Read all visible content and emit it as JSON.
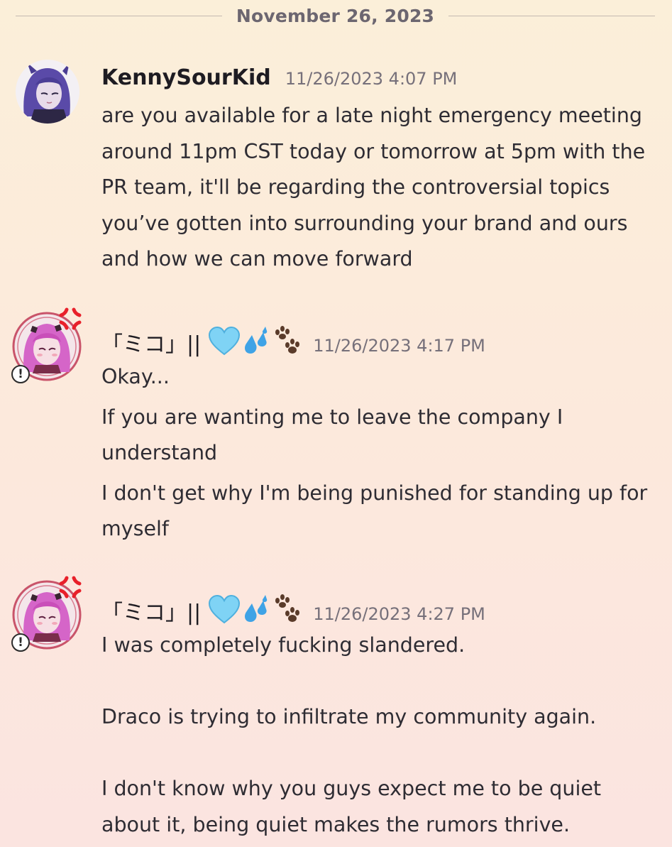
{
  "date_divider": "November 26, 2023",
  "messages": [
    {
      "username": "KennySourKid",
      "timestamp": "11/26/2023 4:07 PM",
      "lines": [
        "are you available for a late night emergency meeting around 11pm CST today or tomorrow at 5pm with the PR team, it'll be regarding the controversial topics you’ve gotten into surrounding your brand and ours and how we can move forward"
      ]
    },
    {
      "username": "「ミコ」||",
      "name_emojis": [
        "blue-heart-icon",
        "sweat-droplets-icon",
        "paw-prints-icon"
      ],
      "timestamp": "11/26/2023 4:17 PM",
      "lines": [
        "Okay...",
        "If you are wanting me to leave the company I understand",
        "I don't get why I'm being punished for standing up for myself"
      ]
    },
    {
      "username": "「ミコ」||",
      "name_emojis": [
        "blue-heart-icon",
        "sweat-droplets-icon",
        "paw-prints-icon"
      ],
      "timestamp": "11/26/2023 4:27 PM",
      "lines": [
        "I was completely fucking slandered.",
        "",
        "Draco is trying to infiltrate my community again.",
        "",
        "I don't know why you guys expect me to be quiet about it, being quiet makes the rumors thrive."
      ]
    }
  ],
  "colors": {
    "background_top": "#fbefd9",
    "background_bottom": "#fbe4e0",
    "text": "#2e2c33",
    "timestamp": "#76707a",
    "heart": "#7fd3f5",
    "droplets": "#3fa3e6",
    "paws": "#5a3b2a",
    "anger": "#e8202a"
  }
}
